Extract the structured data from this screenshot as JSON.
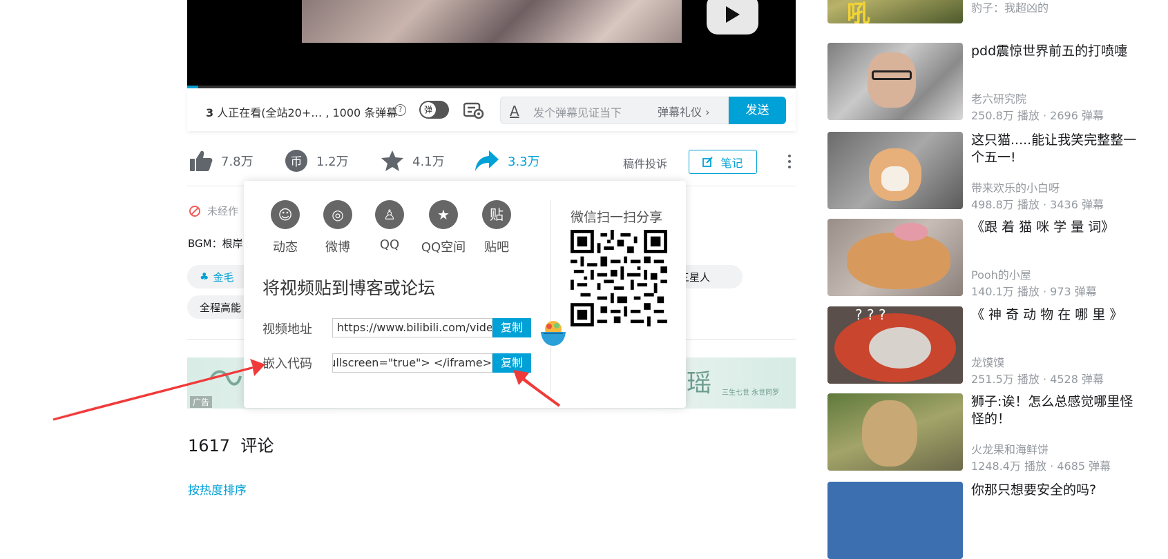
{
  "player": {
    "viewers_count": "3",
    "viewers_text": " 人正在看(全站20+… , 1000 条弹幕",
    "help_glyph": "?",
    "danmaku_toggle_glyph": "弹",
    "danmaku_font_glyph": "A",
    "danmaku_placeholder": "发个弹幕见证当下",
    "danmaku_etiquette": "弹幕礼仪 ›",
    "send_label": "发送"
  },
  "toolbar": {
    "like_count": "7.8万",
    "coin_glyph": "币",
    "coin_count": "1.2万",
    "fav_count": "4.1万",
    "share_count": "3.3万",
    "report_label": "稿件投诉",
    "note_label": "笔记"
  },
  "video_info": {
    "notice": "未经作",
    "bgm": "BGM：根岸",
    "tags": [
      "金毛",
      "全程高能",
      "三星人"
    ]
  },
  "ad": {
    "label": "广告",
    "art_right": "瑶",
    "art_right_small": "三生七世 永世同罗"
  },
  "comments": {
    "count": "1617",
    "title_suffix": "评论",
    "sort_label": "按热度排序"
  },
  "share_popup": {
    "options": [
      {
        "glyph": "☺",
        "label": "动态"
      },
      {
        "glyph": "◎",
        "label": "微博"
      },
      {
        "glyph": "♙",
        "label": "QQ"
      },
      {
        "glyph": "★",
        "label": "QQ空间"
      },
      {
        "glyph": "贴",
        "label": "贴吧"
      }
    ],
    "wechat_title": "微信扫一扫分享",
    "embed_title": "将视频贴到博客或论坛",
    "url_label": "视频地址",
    "url_value": "https://www.bilibili.com/video/B",
    "embed_label": "嵌入代码",
    "embed_value": "owfullscreen=\"true\"> </iframe>",
    "copy_label": "复制"
  },
  "recommendations": [
    {
      "title": "",
      "up": "豹子：我超凶的",
      "stats": ""
    },
    {
      "title": "pdd震惊世界前五的打喷嚏",
      "up": "老六研究院",
      "stats": "250.8万 播放 · 2696 弹幕"
    },
    {
      "title": "这只猫.....能让我笑完整整一个五一!",
      "up": "带来欢乐的小白呀",
      "stats": "498.8万 播放 · 3436 弹幕"
    },
    {
      "title": "《跟 着 猫 咪 学 量 词》",
      "up": "Pooh的小屋",
      "stats": "140.1万 播放 · 973 弹幕"
    },
    {
      "title": "《 神 奇 动 物 在 哪 里 》",
      "up": "龙馍馍",
      "stats": "251.5万 播放 · 4528 弹幕"
    },
    {
      "title": "狮子:诶！怎么总感觉哪里怪怪的！",
      "up": "火龙果和海鲜饼",
      "stats": "1248.4万 播放 · 4685 弹幕"
    },
    {
      "title": "你那只想要安全的吗?",
      "up": "",
      "stats": ""
    }
  ],
  "colors": {
    "accent": "#00a1d6",
    "arrow": "#f03a3a"
  }
}
